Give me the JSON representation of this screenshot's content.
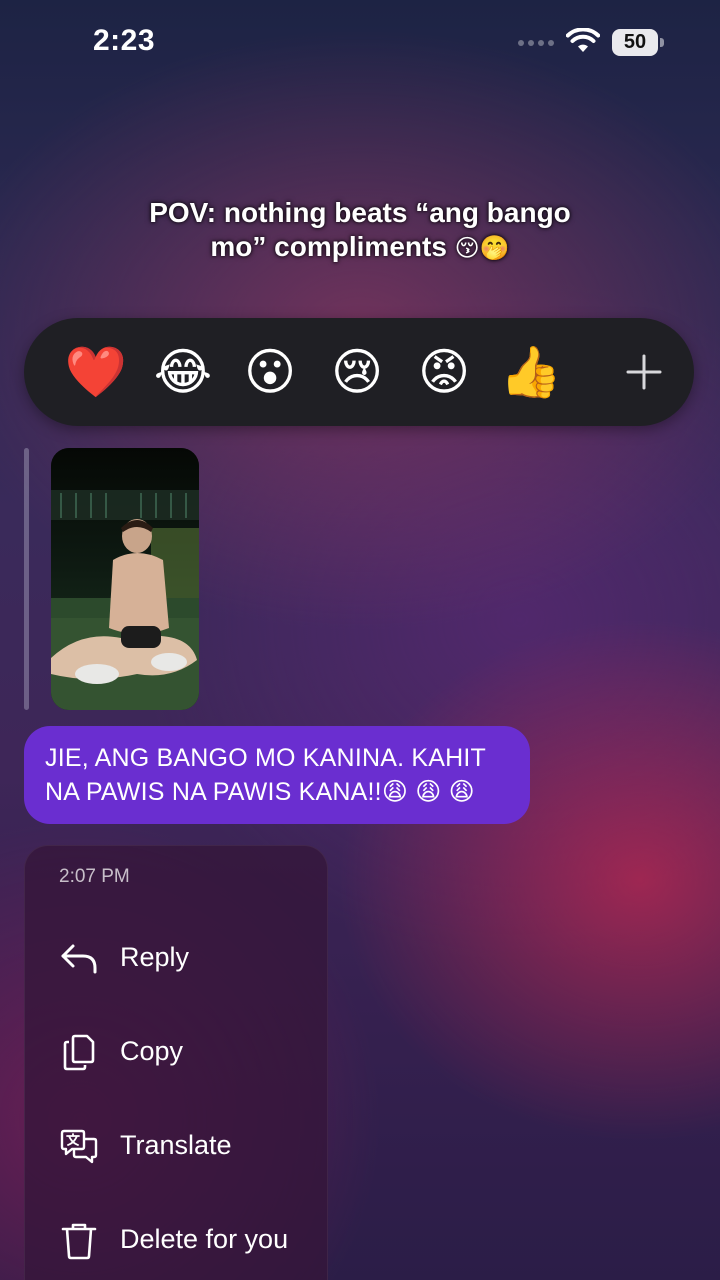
{
  "status_bar": {
    "time": "2:23",
    "battery": "50"
  },
  "caption": {
    "line1": "POV: nothing beats “ang bango",
    "line2": "mo” compliments",
    "emojis": "😚🤭"
  },
  "reactions": {
    "items": [
      {
        "emoji": "❤️",
        "icon": "red-heart"
      },
      {
        "emoji": "😂",
        "icon": "tears-of-joy"
      },
      {
        "emoji": "😮",
        "icon": "surprised-face"
      },
      {
        "emoji": "😢",
        "icon": "crying-face"
      },
      {
        "emoji": "😡",
        "icon": "angry-face"
      },
      {
        "emoji": "👍",
        "icon": "thumbs-up"
      }
    ],
    "more_icon": "plus-icon"
  },
  "message": {
    "text": "JIE, ANG BANGO MO KANINA. KAHIT NA PAWIS NA PAWIS KANA!!😩 😩 😩",
    "bubble_color": "#6a2ed0"
  },
  "menu": {
    "timestamp": "2:07 PM",
    "items": [
      {
        "label": "Reply",
        "icon": "reply-icon"
      },
      {
        "label": "Copy",
        "icon": "copy-icon"
      },
      {
        "label": "Translate",
        "icon": "translate-icon"
      },
      {
        "label": "Delete for you",
        "icon": "trash-icon"
      }
    ]
  }
}
